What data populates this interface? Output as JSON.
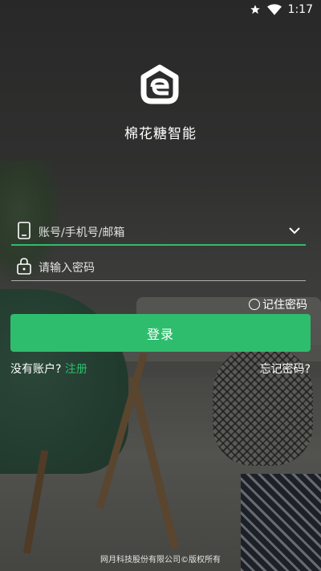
{
  "status_bar": {
    "time": "1:17"
  },
  "app": {
    "name": "棉花糖智能"
  },
  "form": {
    "account_placeholder": "账号/手机号/邮箱",
    "password_placeholder": "请输入密码",
    "remember_label": "记住密码",
    "login_label": "登录"
  },
  "links": {
    "no_account": "没有账户?",
    "register": "注册",
    "forgot": "忘记密码?"
  },
  "footer": {
    "copyright": "网月科技股份有限公司©版权所有"
  },
  "colors": {
    "accent": "#2ebd6d"
  },
  "icons": [
    "star-icon",
    "wifi-icon",
    "phone-icon",
    "lock-icon",
    "chevron-down-icon",
    "app-logo-icon"
  ]
}
